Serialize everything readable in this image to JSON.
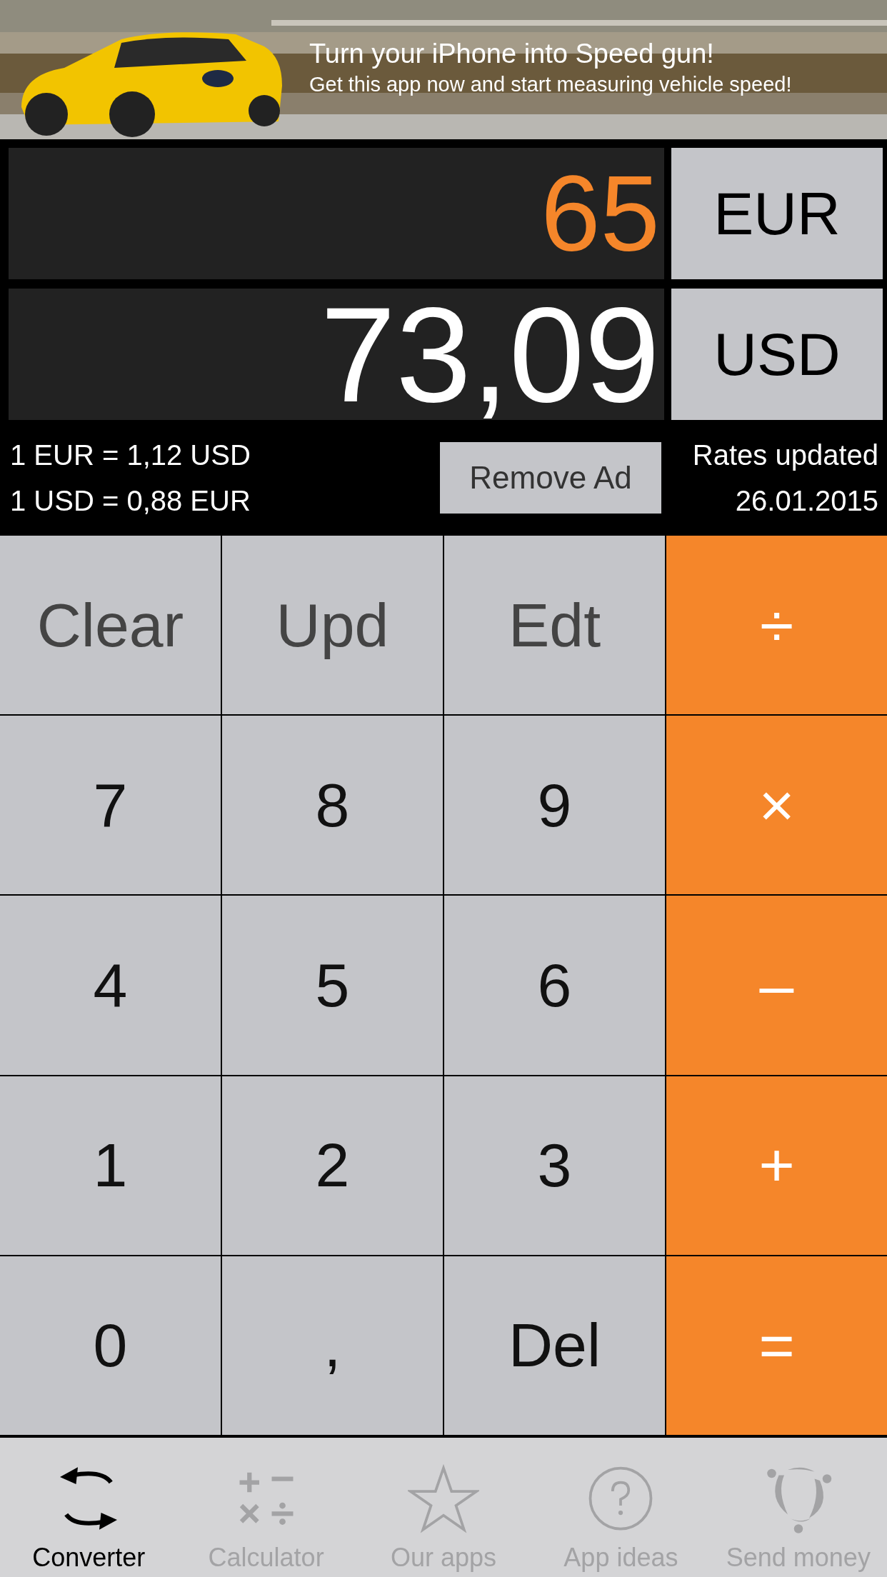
{
  "ad": {
    "headline": "Turn your iPhone into Speed gun!",
    "subline": "Get this app now and start measuring vehicle speed!"
  },
  "display": [
    {
      "amount": "65",
      "currency": "EUR",
      "selected": true
    },
    {
      "amount": "73,09",
      "currency": "USD",
      "selected": false
    }
  ],
  "rates": [
    "1 EUR = 1,12 USD",
    "1 USD = 0,88 EUR"
  ],
  "remove_ad": "Remove Ad",
  "updated": {
    "label": "Rates updated",
    "date": "26.01.2015"
  },
  "keys": [
    {
      "label": "Clear",
      "kind": "function"
    },
    {
      "label": "Upd",
      "kind": "function"
    },
    {
      "label": "Edt",
      "kind": "function"
    },
    {
      "label": "÷",
      "kind": "operator"
    },
    {
      "label": "7",
      "kind": "digit"
    },
    {
      "label": "8",
      "kind": "digit"
    },
    {
      "label": "9",
      "kind": "digit"
    },
    {
      "label": "×",
      "kind": "operator"
    },
    {
      "label": "4",
      "kind": "digit"
    },
    {
      "label": "5",
      "kind": "digit"
    },
    {
      "label": "6",
      "kind": "digit"
    },
    {
      "label": "–",
      "kind": "operator"
    },
    {
      "label": "1",
      "kind": "digit"
    },
    {
      "label": "2",
      "kind": "digit"
    },
    {
      "label": "3",
      "kind": "digit"
    },
    {
      "label": "+",
      "kind": "operator"
    },
    {
      "label": "0",
      "kind": "digit"
    },
    {
      "label": ",",
      "kind": "digit"
    },
    {
      "label": "Del",
      "kind": "digit"
    },
    {
      "label": "=",
      "kind": "operator"
    }
  ],
  "tabs": [
    {
      "label": "Converter",
      "selected": true
    },
    {
      "label": "Calculator",
      "selected": false
    },
    {
      "label": "Our apps",
      "selected": false
    },
    {
      "label": "App ideas",
      "selected": false
    },
    {
      "label": "Send money",
      "selected": false
    }
  ]
}
